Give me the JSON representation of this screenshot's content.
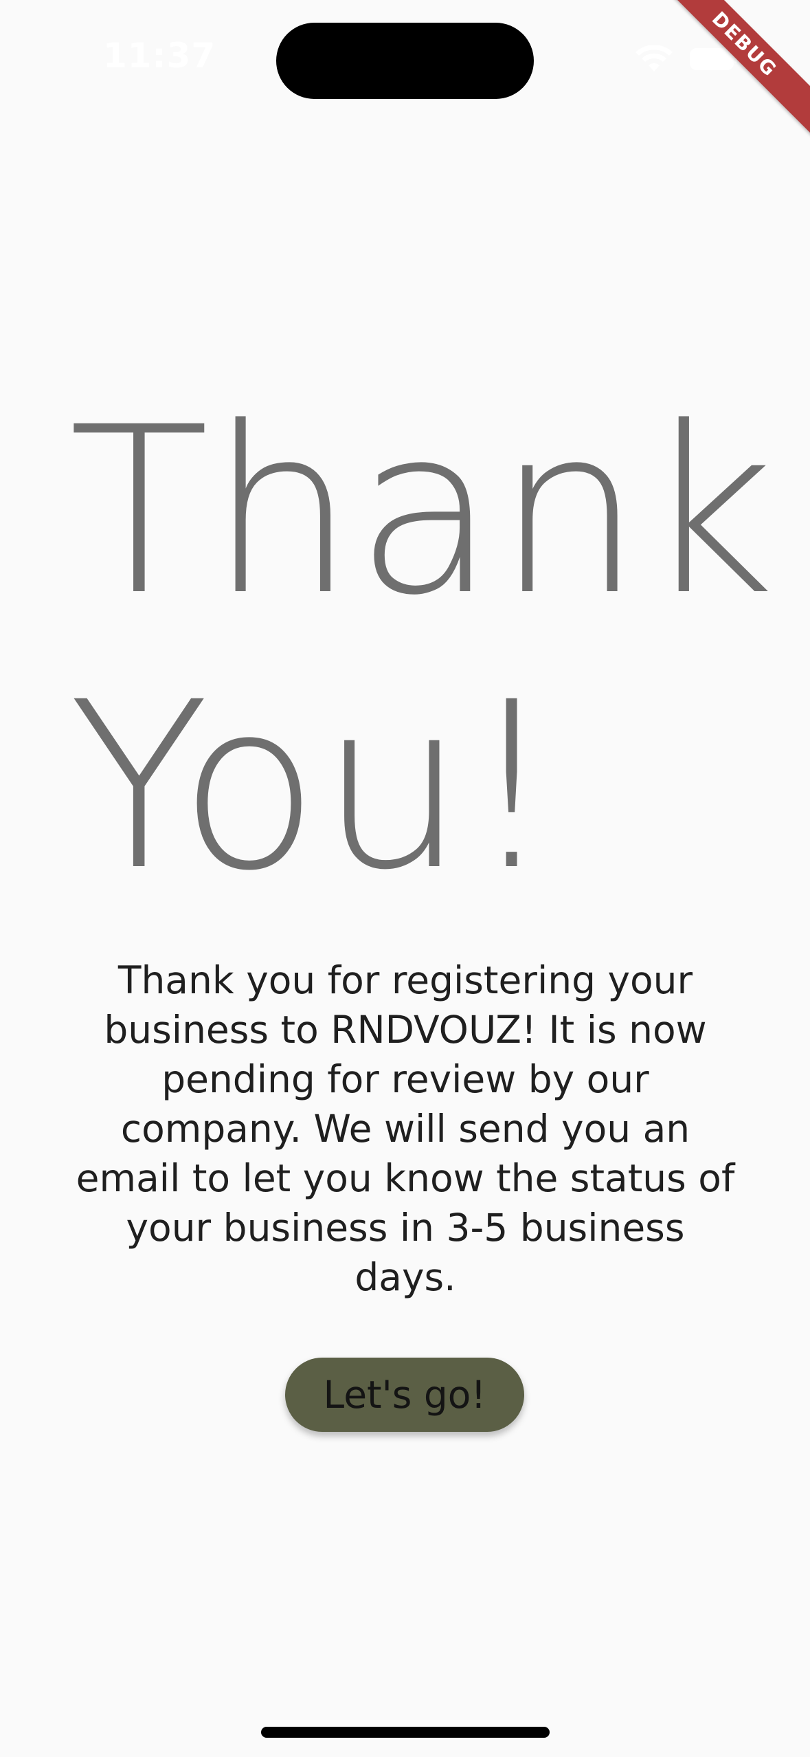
{
  "status_bar": {
    "time": "11:37"
  },
  "debug_banner": {
    "label": "DEBUG"
  },
  "headline": {
    "line1": "Thank",
    "line2": "You!"
  },
  "message": {
    "text": "Thank you for registering your business to RNDVOUZ! It is now pending for review by our company. We will send you an email to let you know the status of your business in 3-5 business days."
  },
  "cta": {
    "label": "Let's go!"
  },
  "colors": {
    "background": "#fafafa",
    "headline": "#6f6f6f",
    "body_text": "#1f1f1f",
    "button": "#5b5f45",
    "debug_banner": "#b23c3c"
  },
  "icons": [
    "wifi-icon",
    "battery-icon"
  ]
}
